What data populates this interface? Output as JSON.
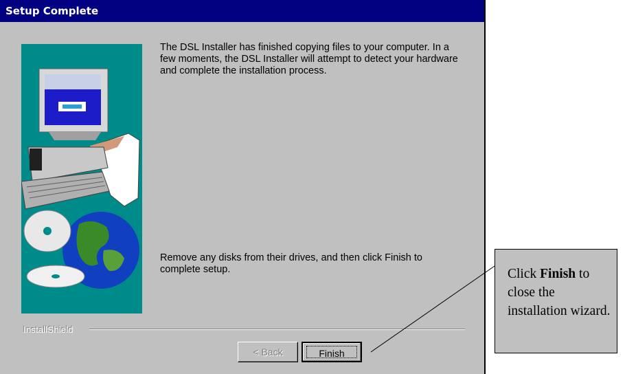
{
  "window": {
    "title": "Setup Complete"
  },
  "message": {
    "line1": "The DSL Installer has finished copying files to your computer.  In a few moments, the DSL Installer will attempt to detect your hardware and complete the installation process.",
    "line2": "Remove any disks from their drives, and then click Finish to complete setup."
  },
  "footer": {
    "brand": "InstallShield"
  },
  "buttons": {
    "back": "< Back",
    "finish": "Finish"
  },
  "callout": {
    "prefix": "Click ",
    "bold": "Finish",
    "suffix": " to close the installation wizard."
  },
  "colors": {
    "titlebar": "#000080",
    "dialog": "#c0c0c0",
    "side_panel": "#008b8b"
  }
}
